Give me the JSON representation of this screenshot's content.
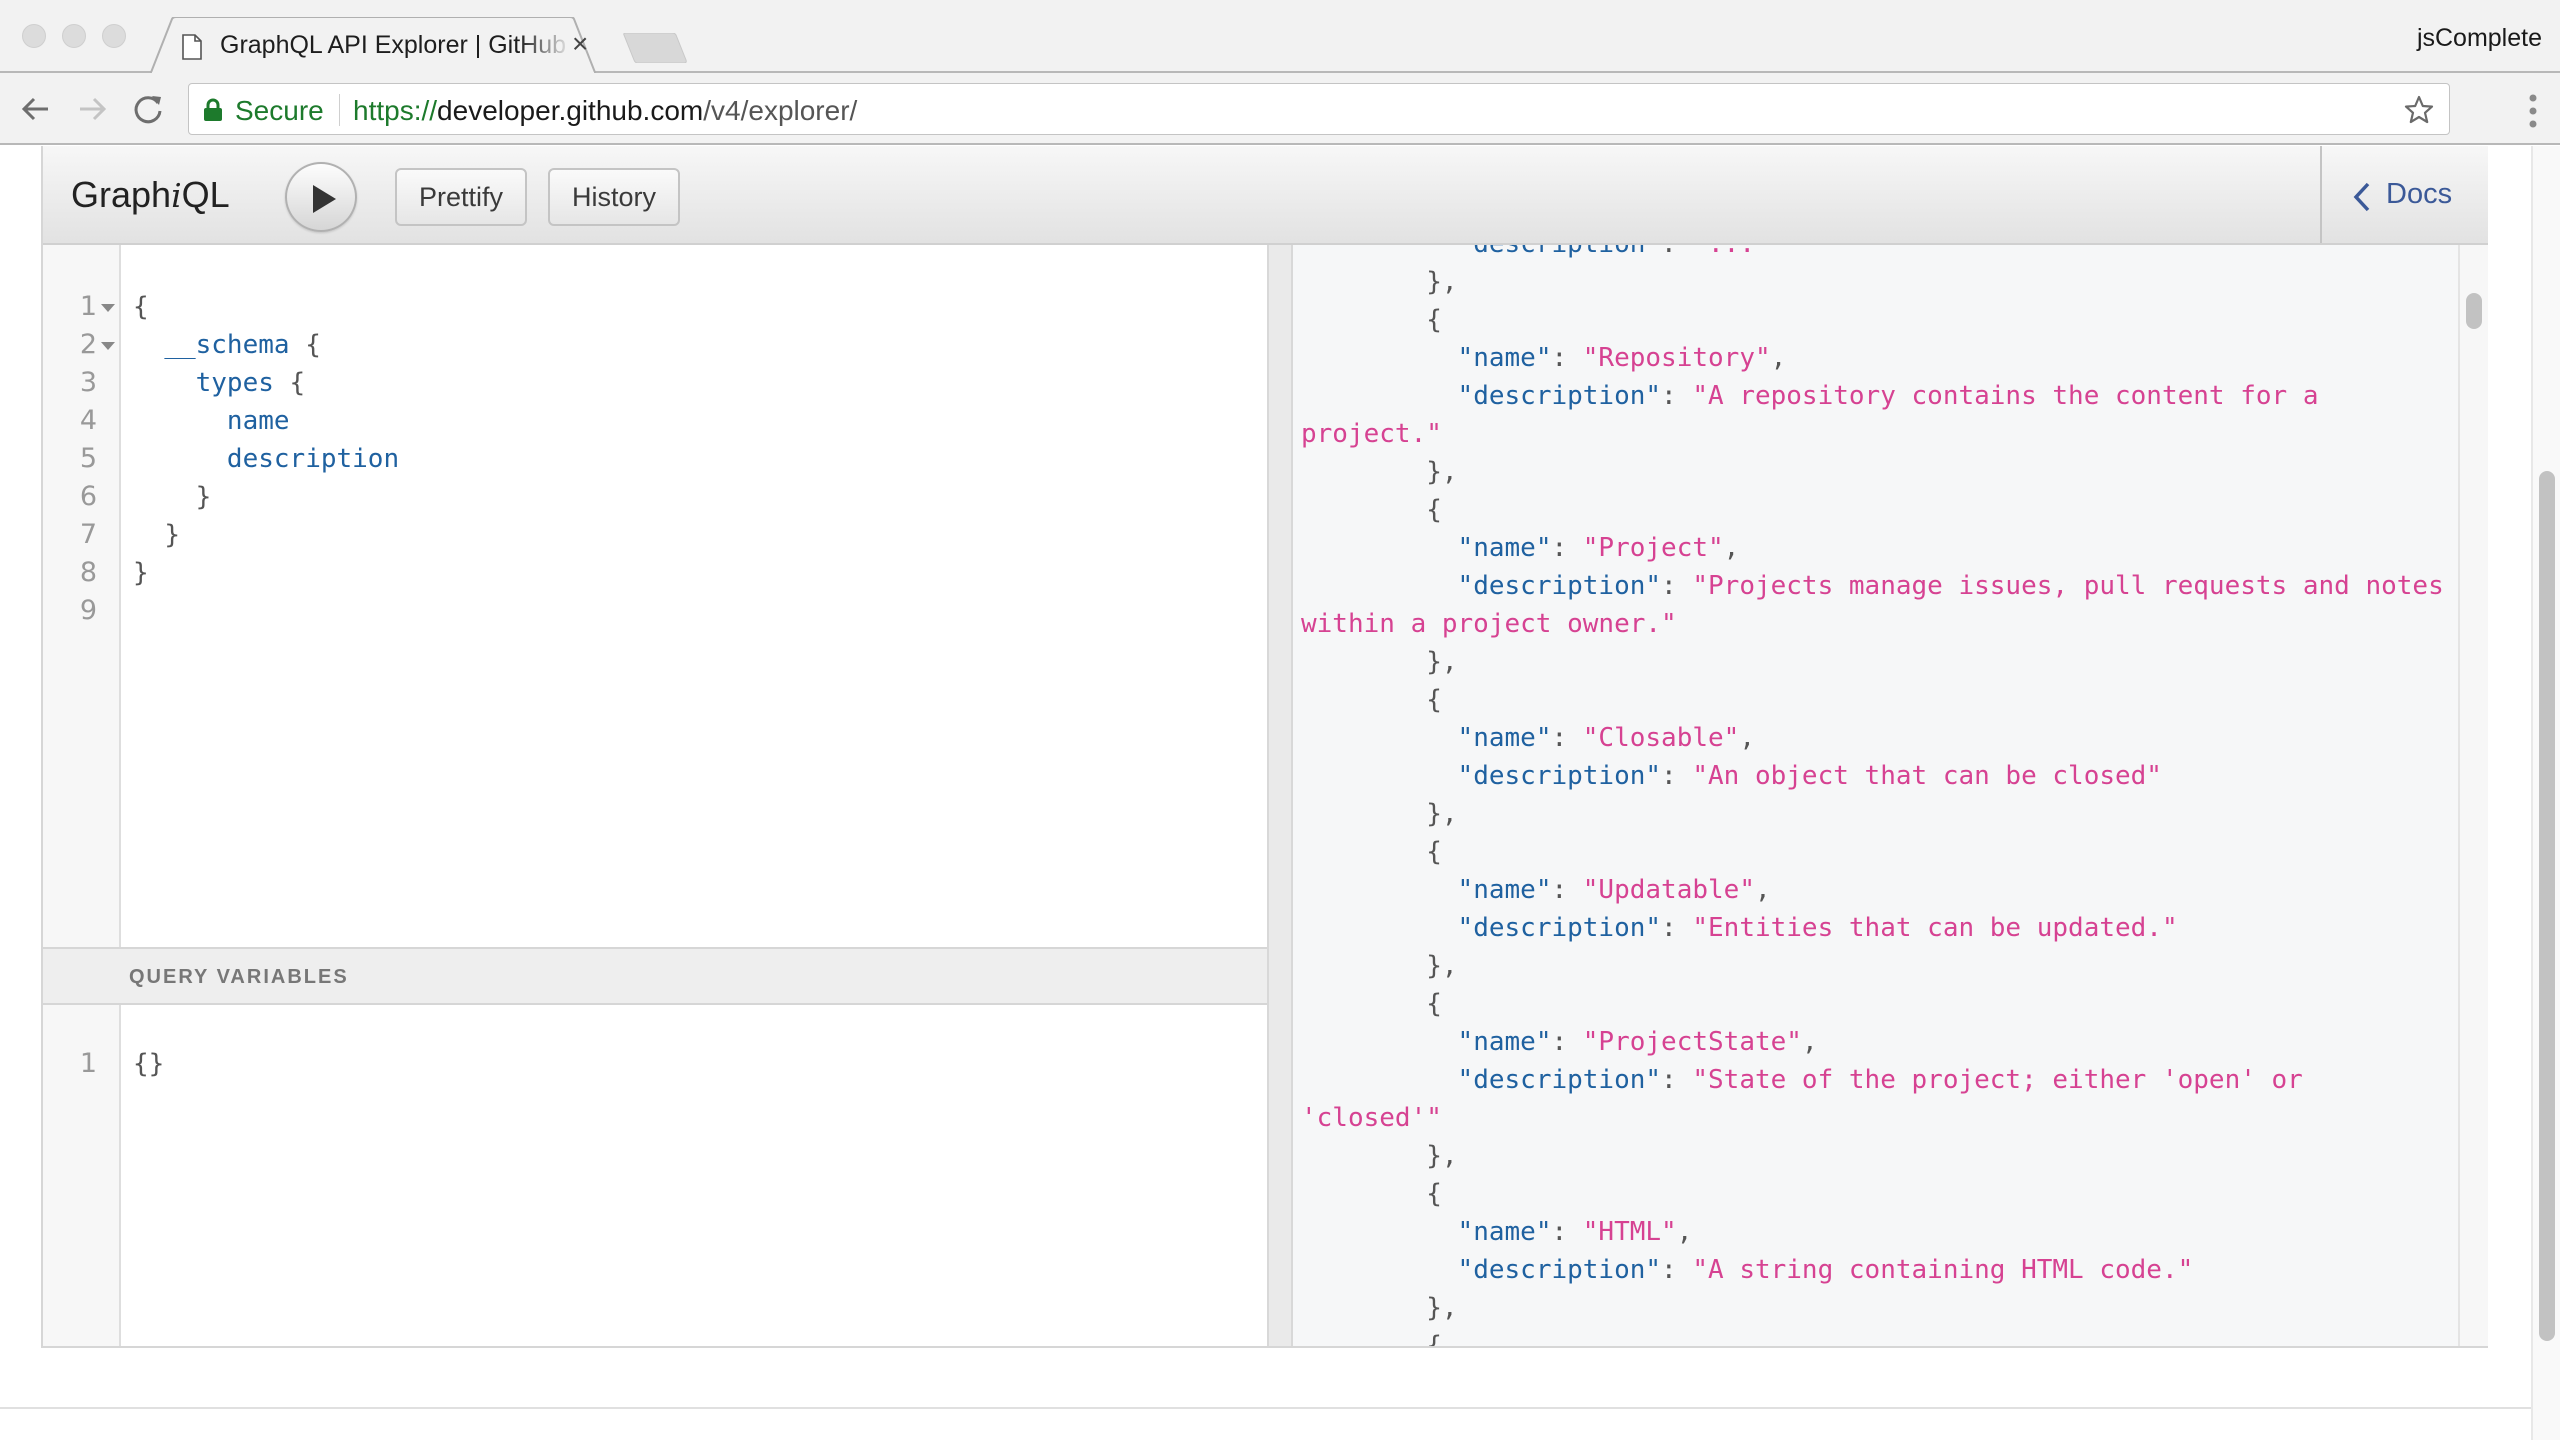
{
  "browser": {
    "tab_title": "GraphQL API Explorer | GitHub",
    "tab_close": "×",
    "profile_name": "jsComplete",
    "secure_label": "Secure",
    "url_scheme": "https://",
    "url_host": "developer.github.com",
    "url_path": "/v4/explorer/",
    "icons": {
      "back": "arrow-left-icon",
      "forward": "arrow-right-icon",
      "reload": "reload-icon",
      "lock": "lock-icon",
      "bookmark": "star-icon",
      "menu": "kebab-menu-icon",
      "favicon": "page-icon"
    }
  },
  "graphiql": {
    "logo_prefix": "Graph",
    "logo_i": "i",
    "logo_suffix": "QL",
    "execute_icon": "play-icon",
    "prettify_label": "Prettify",
    "history_label": "History",
    "docs_label": "Docs",
    "query_editor": {
      "lines": [
        {
          "n": "1",
          "fold": true,
          "indent": "",
          "keyword": "",
          "punct": "{"
        },
        {
          "n": "2",
          "fold": true,
          "indent": "  ",
          "keyword": "__schema",
          "punct": " {"
        },
        {
          "n": "3",
          "fold": false,
          "indent": "    ",
          "keyword": "types",
          "punct": " {"
        },
        {
          "n": "4",
          "fold": false,
          "indent": "      ",
          "keyword": "name",
          "punct": ""
        },
        {
          "n": "5",
          "fold": false,
          "indent": "      ",
          "keyword": "description",
          "punct": ""
        },
        {
          "n": "6",
          "fold": false,
          "indent": "    ",
          "keyword": "",
          "punct": "}"
        },
        {
          "n": "7",
          "fold": false,
          "indent": "  ",
          "keyword": "",
          "punct": "}"
        },
        {
          "n": "8",
          "fold": false,
          "indent": "",
          "keyword": "",
          "punct": "}"
        },
        {
          "n": "9",
          "fold": false,
          "indent": "",
          "keyword": "",
          "punct": ""
        }
      ]
    },
    "variables": {
      "header": "QUERY VARIABLES",
      "lines": [
        {
          "n": "1",
          "text": "{}"
        }
      ]
    },
    "results": {
      "lines": [
        {
          "parts": [
            [
              "rp",
              "          "
            ],
            [
              "rk",
              "\"description\""
            ],
            [
              "rp",
              ": "
            ],
            [
              "rs",
              "\"...\""
            ]
          ],
          "clipped": true
        },
        {
          "parts": [
            [
              "rp",
              "        },"
            ]
          ]
        },
        {
          "parts": [
            [
              "rp",
              "        {"
            ]
          ]
        },
        {
          "parts": [
            [
              "rp",
              "          "
            ],
            [
              "rk",
              "\"name\""
            ],
            [
              "rp",
              ": "
            ],
            [
              "rs",
              "\"Repository\""
            ],
            [
              "rp",
              ","
            ]
          ]
        },
        {
          "parts": [
            [
              "rp",
              "          "
            ],
            [
              "rk",
              "\"description\""
            ],
            [
              "rp",
              ": "
            ],
            [
              "rs",
              "\"A repository contains the content for a"
            ]
          ]
        },
        {
          "parts": [
            [
              "rs",
              "project.\""
            ]
          ]
        },
        {
          "parts": [
            [
              "rp",
              "        },"
            ]
          ]
        },
        {
          "parts": [
            [
              "rp",
              "        {"
            ]
          ]
        },
        {
          "parts": [
            [
              "rp",
              "          "
            ],
            [
              "rk",
              "\"name\""
            ],
            [
              "rp",
              ": "
            ],
            [
              "rs",
              "\"Project\""
            ],
            [
              "rp",
              ","
            ]
          ]
        },
        {
          "parts": [
            [
              "rp",
              "          "
            ],
            [
              "rk",
              "\"description\""
            ],
            [
              "rp",
              ": "
            ],
            [
              "rs",
              "\"Projects manage issues, pull requests and notes"
            ]
          ]
        },
        {
          "parts": [
            [
              "rs",
              "within a project owner.\""
            ]
          ]
        },
        {
          "parts": [
            [
              "rp",
              "        },"
            ]
          ]
        },
        {
          "parts": [
            [
              "rp",
              "        {"
            ]
          ]
        },
        {
          "parts": [
            [
              "rp",
              "          "
            ],
            [
              "rk",
              "\"name\""
            ],
            [
              "rp",
              ": "
            ],
            [
              "rs",
              "\"Closable\""
            ],
            [
              "rp",
              ","
            ]
          ]
        },
        {
          "parts": [
            [
              "rp",
              "          "
            ],
            [
              "rk",
              "\"description\""
            ],
            [
              "rp",
              ": "
            ],
            [
              "rs",
              "\"An object that can be closed\""
            ]
          ]
        },
        {
          "parts": [
            [
              "rp",
              "        },"
            ]
          ]
        },
        {
          "parts": [
            [
              "rp",
              "        {"
            ]
          ]
        },
        {
          "parts": [
            [
              "rp",
              "          "
            ],
            [
              "rk",
              "\"name\""
            ],
            [
              "rp",
              ": "
            ],
            [
              "rs",
              "\"Updatable\""
            ],
            [
              "rp",
              ","
            ]
          ]
        },
        {
          "parts": [
            [
              "rp",
              "          "
            ],
            [
              "rk",
              "\"description\""
            ],
            [
              "rp",
              ": "
            ],
            [
              "rs",
              "\"Entities that can be updated.\""
            ]
          ]
        },
        {
          "parts": [
            [
              "rp",
              "        },"
            ]
          ]
        },
        {
          "parts": [
            [
              "rp",
              "        {"
            ]
          ]
        },
        {
          "parts": [
            [
              "rp",
              "          "
            ],
            [
              "rk",
              "\"name\""
            ],
            [
              "rp",
              ": "
            ],
            [
              "rs",
              "\"ProjectState\""
            ],
            [
              "rp",
              ","
            ]
          ]
        },
        {
          "parts": [
            [
              "rp",
              "          "
            ],
            [
              "rk",
              "\"description\""
            ],
            [
              "rp",
              ": "
            ],
            [
              "rs",
              "\"State of the project; either 'open' or"
            ]
          ]
        },
        {
          "parts": [
            [
              "rs",
              "'closed'\""
            ]
          ]
        },
        {
          "parts": [
            [
              "rp",
              "        },"
            ]
          ]
        },
        {
          "parts": [
            [
              "rp",
              "        {"
            ]
          ]
        },
        {
          "parts": [
            [
              "rp",
              "          "
            ],
            [
              "rk",
              "\"name\""
            ],
            [
              "rp",
              ": "
            ],
            [
              "rs",
              "\"HTML\""
            ],
            [
              "rp",
              ","
            ]
          ]
        },
        {
          "parts": [
            [
              "rp",
              "          "
            ],
            [
              "rk",
              "\"description\""
            ],
            [
              "rp",
              ": "
            ],
            [
              "rs",
              "\"A string containing HTML code.\""
            ]
          ]
        },
        {
          "parts": [
            [
              "rp",
              "        },"
            ]
          ]
        },
        {
          "parts": [
            [
              "rp",
              "        {"
            ]
          ]
        }
      ]
    }
  },
  "colors": {
    "secure_green": "#1d7a2c",
    "keyword_blue": "#1f61a0",
    "string_pink": "#d64292",
    "docs_link": "#3b5998"
  }
}
